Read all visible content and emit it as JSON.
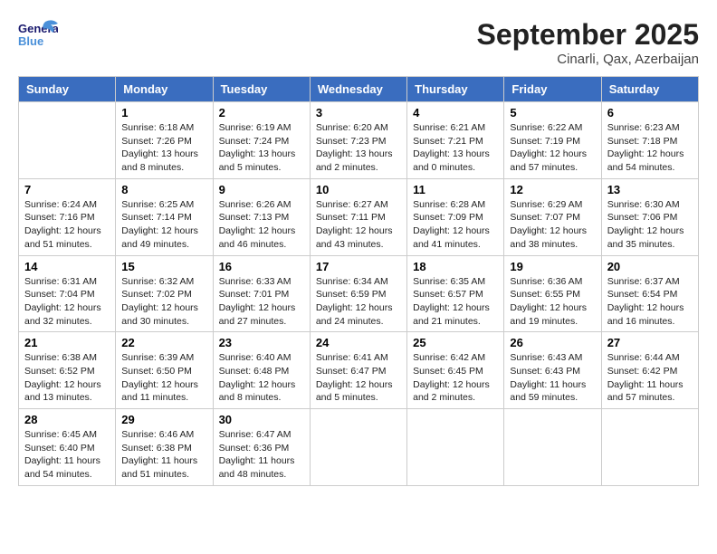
{
  "header": {
    "logo_line1": "General",
    "logo_line2": "Blue",
    "month": "September 2025",
    "location": "Cinarli, Qax, Azerbaijan"
  },
  "weekdays": [
    "Sunday",
    "Monday",
    "Tuesday",
    "Wednesday",
    "Thursday",
    "Friday",
    "Saturday"
  ],
  "weeks": [
    [
      {
        "day": "",
        "sunrise": "",
        "sunset": "",
        "daylight": ""
      },
      {
        "day": "1",
        "sunrise": "Sunrise: 6:18 AM",
        "sunset": "Sunset: 7:26 PM",
        "daylight": "Daylight: 13 hours and 8 minutes."
      },
      {
        "day": "2",
        "sunrise": "Sunrise: 6:19 AM",
        "sunset": "Sunset: 7:24 PM",
        "daylight": "Daylight: 13 hours and 5 minutes."
      },
      {
        "day": "3",
        "sunrise": "Sunrise: 6:20 AM",
        "sunset": "Sunset: 7:23 PM",
        "daylight": "Daylight: 13 hours and 2 minutes."
      },
      {
        "day": "4",
        "sunrise": "Sunrise: 6:21 AM",
        "sunset": "Sunset: 7:21 PM",
        "daylight": "Daylight: 13 hours and 0 minutes."
      },
      {
        "day": "5",
        "sunrise": "Sunrise: 6:22 AM",
        "sunset": "Sunset: 7:19 PM",
        "daylight": "Daylight: 12 hours and 57 minutes."
      },
      {
        "day": "6",
        "sunrise": "Sunrise: 6:23 AM",
        "sunset": "Sunset: 7:18 PM",
        "daylight": "Daylight: 12 hours and 54 minutes."
      }
    ],
    [
      {
        "day": "7",
        "sunrise": "Sunrise: 6:24 AM",
        "sunset": "Sunset: 7:16 PM",
        "daylight": "Daylight: 12 hours and 51 minutes."
      },
      {
        "day": "8",
        "sunrise": "Sunrise: 6:25 AM",
        "sunset": "Sunset: 7:14 PM",
        "daylight": "Daylight: 12 hours and 49 minutes."
      },
      {
        "day": "9",
        "sunrise": "Sunrise: 6:26 AM",
        "sunset": "Sunset: 7:13 PM",
        "daylight": "Daylight: 12 hours and 46 minutes."
      },
      {
        "day": "10",
        "sunrise": "Sunrise: 6:27 AM",
        "sunset": "Sunset: 7:11 PM",
        "daylight": "Daylight: 12 hours and 43 minutes."
      },
      {
        "day": "11",
        "sunrise": "Sunrise: 6:28 AM",
        "sunset": "Sunset: 7:09 PM",
        "daylight": "Daylight: 12 hours and 41 minutes."
      },
      {
        "day": "12",
        "sunrise": "Sunrise: 6:29 AM",
        "sunset": "Sunset: 7:07 PM",
        "daylight": "Daylight: 12 hours and 38 minutes."
      },
      {
        "day": "13",
        "sunrise": "Sunrise: 6:30 AM",
        "sunset": "Sunset: 7:06 PM",
        "daylight": "Daylight: 12 hours and 35 minutes."
      }
    ],
    [
      {
        "day": "14",
        "sunrise": "Sunrise: 6:31 AM",
        "sunset": "Sunset: 7:04 PM",
        "daylight": "Daylight: 12 hours and 32 minutes."
      },
      {
        "day": "15",
        "sunrise": "Sunrise: 6:32 AM",
        "sunset": "Sunset: 7:02 PM",
        "daylight": "Daylight: 12 hours and 30 minutes."
      },
      {
        "day": "16",
        "sunrise": "Sunrise: 6:33 AM",
        "sunset": "Sunset: 7:01 PM",
        "daylight": "Daylight: 12 hours and 27 minutes."
      },
      {
        "day": "17",
        "sunrise": "Sunrise: 6:34 AM",
        "sunset": "Sunset: 6:59 PM",
        "daylight": "Daylight: 12 hours and 24 minutes."
      },
      {
        "day": "18",
        "sunrise": "Sunrise: 6:35 AM",
        "sunset": "Sunset: 6:57 PM",
        "daylight": "Daylight: 12 hours and 21 minutes."
      },
      {
        "day": "19",
        "sunrise": "Sunrise: 6:36 AM",
        "sunset": "Sunset: 6:55 PM",
        "daylight": "Daylight: 12 hours and 19 minutes."
      },
      {
        "day": "20",
        "sunrise": "Sunrise: 6:37 AM",
        "sunset": "Sunset: 6:54 PM",
        "daylight": "Daylight: 12 hours and 16 minutes."
      }
    ],
    [
      {
        "day": "21",
        "sunrise": "Sunrise: 6:38 AM",
        "sunset": "Sunset: 6:52 PM",
        "daylight": "Daylight: 12 hours and 13 minutes."
      },
      {
        "day": "22",
        "sunrise": "Sunrise: 6:39 AM",
        "sunset": "Sunset: 6:50 PM",
        "daylight": "Daylight: 12 hours and 11 minutes."
      },
      {
        "day": "23",
        "sunrise": "Sunrise: 6:40 AM",
        "sunset": "Sunset: 6:48 PM",
        "daylight": "Daylight: 12 hours and 8 minutes."
      },
      {
        "day": "24",
        "sunrise": "Sunrise: 6:41 AM",
        "sunset": "Sunset: 6:47 PM",
        "daylight": "Daylight: 12 hours and 5 minutes."
      },
      {
        "day": "25",
        "sunrise": "Sunrise: 6:42 AM",
        "sunset": "Sunset: 6:45 PM",
        "daylight": "Daylight: 12 hours and 2 minutes."
      },
      {
        "day": "26",
        "sunrise": "Sunrise: 6:43 AM",
        "sunset": "Sunset: 6:43 PM",
        "daylight": "Daylight: 11 hours and 59 minutes."
      },
      {
        "day": "27",
        "sunrise": "Sunrise: 6:44 AM",
        "sunset": "Sunset: 6:42 PM",
        "daylight": "Daylight: 11 hours and 57 minutes."
      }
    ],
    [
      {
        "day": "28",
        "sunrise": "Sunrise: 6:45 AM",
        "sunset": "Sunset: 6:40 PM",
        "daylight": "Daylight: 11 hours and 54 minutes."
      },
      {
        "day": "29",
        "sunrise": "Sunrise: 6:46 AM",
        "sunset": "Sunset: 6:38 PM",
        "daylight": "Daylight: 11 hours and 51 minutes."
      },
      {
        "day": "30",
        "sunrise": "Sunrise: 6:47 AM",
        "sunset": "Sunset: 6:36 PM",
        "daylight": "Daylight: 11 hours and 48 minutes."
      },
      {
        "day": "",
        "sunrise": "",
        "sunset": "",
        "daylight": ""
      },
      {
        "day": "",
        "sunrise": "",
        "sunset": "",
        "daylight": ""
      },
      {
        "day": "",
        "sunrise": "",
        "sunset": "",
        "daylight": ""
      },
      {
        "day": "",
        "sunrise": "",
        "sunset": "",
        "daylight": ""
      }
    ]
  ]
}
